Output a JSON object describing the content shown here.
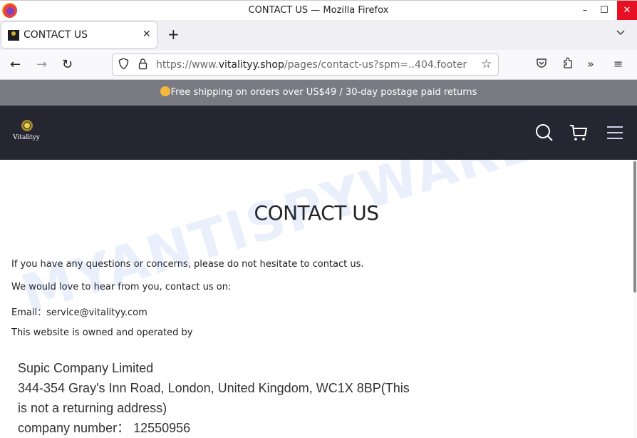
{
  "window": {
    "title": "CONTACT US — Mozilla Firefox",
    "minimize_glyph": "–",
    "maximize_glyph": "☐",
    "close_glyph": "✕"
  },
  "tabs": [
    {
      "label": "CONTACT US",
      "close_glyph": "✕",
      "active": true
    }
  ],
  "tabstrip": {
    "new_tab_glyph": "+",
    "list_all_tabs_glyph": "⌄"
  },
  "navbar": {
    "back_glyph": "←",
    "forward_glyph": "→",
    "reload_glyph": "↻",
    "url_prefix": "https://www.",
    "url_domain": "vitalityy.shop",
    "url_path": "/pages/contact-us?spm=..404.footer",
    "bookmark_glyph": "☆",
    "pocket_glyph": "⛉",
    "extensions_glyph": "⧉",
    "overflow_glyph": "»",
    "menu_glyph": "≡"
  },
  "announcement": {
    "text": "Free shipping on orders over US$49 / 30-day postage paid returns"
  },
  "site_header": {
    "logo_text": "Vitalityy",
    "icons": [
      "search-icon",
      "cart-icon",
      "hamburger-menu-icon"
    ]
  },
  "main": {
    "title": "CONTACT US",
    "paragraphs": [
      "If you have any questions or concerns, please do not hesitate to contact us.",
      "We would love to hear from you, contact us on:",
      "Email：service@vitalityy.com",
      "This website is owned and operated by"
    ],
    "company": {
      "name": "Supic Company Limited",
      "address": "344-354 Gray's Inn Road, London, United Kingdom, WC1X 8BP(This is not a returning address)",
      "number": "company number： 12550956"
    }
  },
  "watermark": "MYANTISPYWARE.COM",
  "colors": {
    "header_bg": "#262632",
    "announce_bg": "#7a7a82",
    "logo_gold": "#ecd04a",
    "close_red": "#e81123"
  }
}
